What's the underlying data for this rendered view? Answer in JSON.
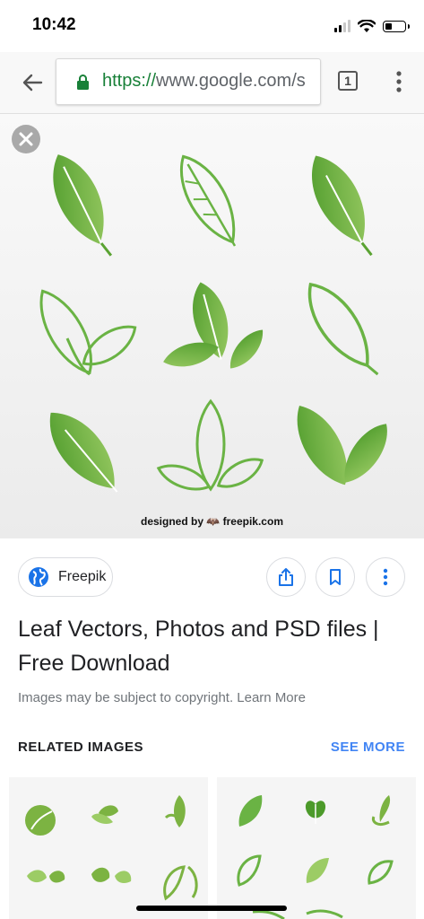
{
  "status_bar": {
    "time": "10:42",
    "icons": [
      "signal-icon",
      "wifi-icon",
      "battery-icon"
    ]
  },
  "browser": {
    "url_scheme": "https://",
    "url_rest": "www.google.com/s",
    "tab_count": "1",
    "icons": [
      "back-arrow-icon",
      "lock-icon",
      "more-vert-icon"
    ]
  },
  "image_viewer": {
    "credit": "designed by 🦇 freepik.com",
    "close_icon": "close-icon"
  },
  "result": {
    "source_name": "Freepik",
    "title": "Leaf Vectors, Photos and PSD files | Free Download",
    "copyright_notice": "Images may be subject to copyright. Learn More",
    "action_icons": [
      "share-icon",
      "bookmark-icon",
      "more-vert-icon"
    ]
  },
  "related": {
    "heading": "RELATED IMAGES",
    "see_more": "SEE MORE"
  },
  "colors": {
    "accent_blue": "#4285f4",
    "url_green": "#188038",
    "leaf_green": "#6ab344"
  }
}
